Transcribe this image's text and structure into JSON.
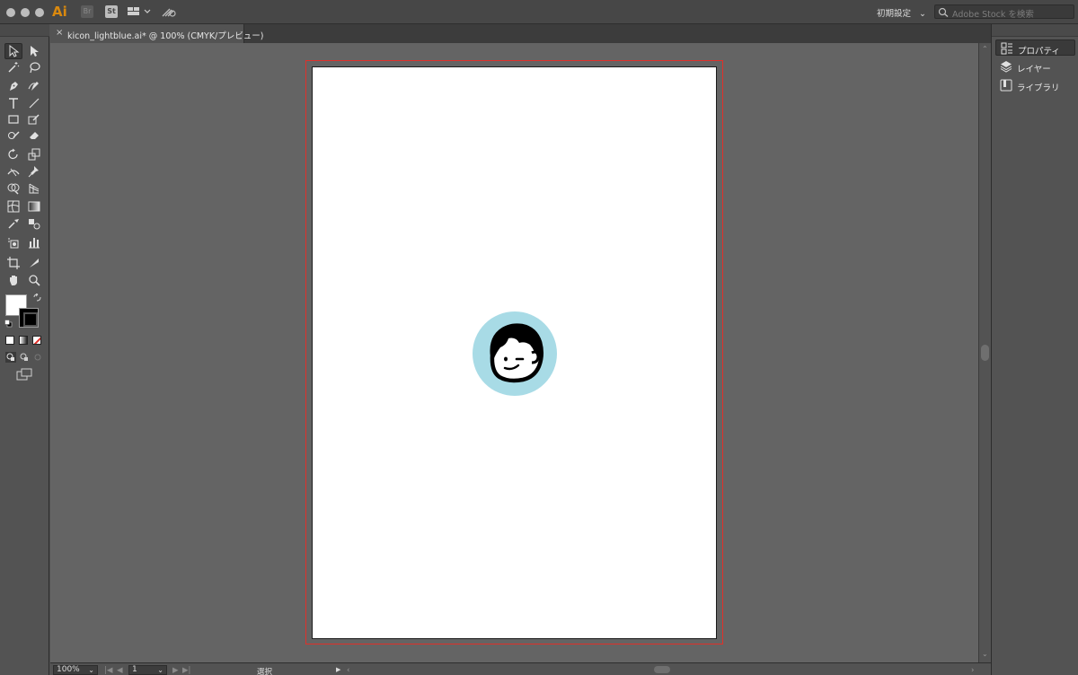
{
  "appbar": {
    "app_logo": "Ai",
    "bridge_label": "Br",
    "stock_label": "St",
    "workspace": "初期設定",
    "search_placeholder": "Adobe Stock を検索"
  },
  "document_tab": {
    "close_glyph": "×",
    "title": "kicon_lightblue.ai* @ 100% (CMYK/プレビュー)"
  },
  "right_panel": {
    "items": [
      {
        "label": "プロパティ",
        "icon": "properties-icon"
      },
      {
        "label": "レイヤー",
        "icon": "layers-icon"
      },
      {
        "label": "ライブラリ",
        "icon": "libraries-icon"
      }
    ]
  },
  "statusbar": {
    "zoom": "100%",
    "artboard_number": "1",
    "status_text": "選択"
  },
  "colors": {
    "accent_orange": "#ff9a00",
    "bleed_red": "#e0302a",
    "avatar_bg": "#a8dbe6"
  }
}
